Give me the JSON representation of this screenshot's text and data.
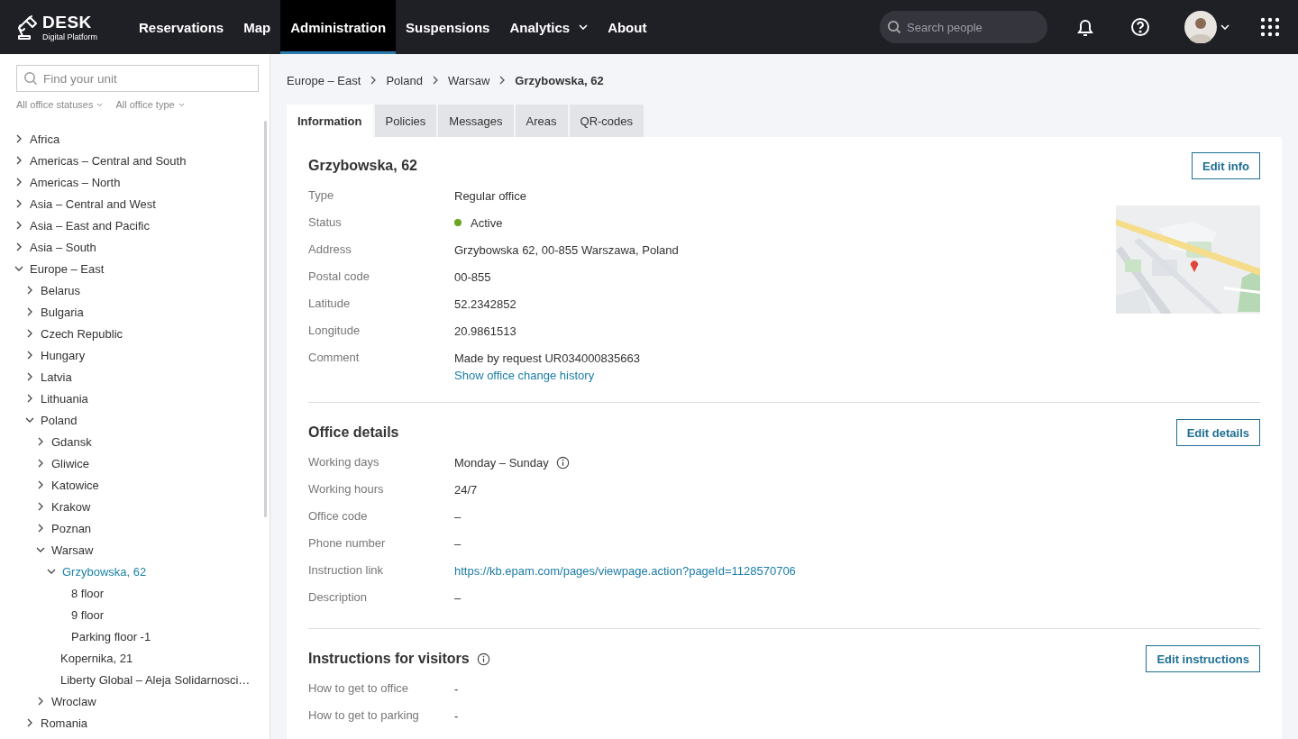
{
  "header": {
    "logo": {
      "title": "DESK",
      "subtitle": "Digital Platform"
    },
    "nav": [
      {
        "label": "Reservations",
        "selected": false,
        "dropdown": false
      },
      {
        "label": "Map",
        "selected": false,
        "dropdown": false
      },
      {
        "label": "Administration",
        "selected": true,
        "dropdown": false
      },
      {
        "label": "Suspensions",
        "selected": false,
        "dropdown": false
      },
      {
        "label": "Analytics",
        "selected": false,
        "dropdown": true
      },
      {
        "label": "About",
        "selected": false,
        "dropdown": false
      }
    ],
    "search": {
      "placeholder": "Search people"
    }
  },
  "sidebar": {
    "search": {
      "placeholder": "Find your unit"
    },
    "filters": [
      "All office statuses",
      "All office type"
    ],
    "tree": [
      {
        "label": "Africa",
        "kind": "group",
        "expanded": false,
        "selected": false
      },
      {
        "label": "Americas – Central and South",
        "kind": "group",
        "expanded": false,
        "selected": false
      },
      {
        "label": "Americas – North",
        "kind": "group",
        "expanded": false,
        "selected": false
      },
      {
        "label": "Asia – Central and West",
        "kind": "group",
        "expanded": false,
        "selected": false
      },
      {
        "label": "Asia – East and Pacific",
        "kind": "group",
        "expanded": false,
        "selected": false
      },
      {
        "label": "Asia – South",
        "kind": "group",
        "expanded": false,
        "selected": false
      },
      {
        "label": "Europe – East",
        "kind": "group",
        "expanded": true,
        "selected": false,
        "children": [
          {
            "label": "Belarus",
            "kind": "group",
            "expanded": false,
            "selected": false
          },
          {
            "label": "Bulgaria",
            "kind": "group",
            "expanded": false,
            "selected": false
          },
          {
            "label": "Czech Republic",
            "kind": "group",
            "expanded": false,
            "selected": false
          },
          {
            "label": "Hungary",
            "kind": "group",
            "expanded": false,
            "selected": false
          },
          {
            "label": "Latvia",
            "kind": "group",
            "expanded": false,
            "selected": false
          },
          {
            "label": "Lithuania",
            "kind": "group",
            "expanded": false,
            "selected": false
          },
          {
            "label": "Poland",
            "kind": "group",
            "expanded": true,
            "selected": false,
            "children": [
              {
                "label": "Gdansk",
                "kind": "group",
                "expanded": false,
                "selected": false
              },
              {
                "label": "Gliwice",
                "kind": "group",
                "expanded": false,
                "selected": false
              },
              {
                "label": "Katowice",
                "kind": "group",
                "expanded": false,
                "selected": false
              },
              {
                "label": "Krakow",
                "kind": "group",
                "expanded": false,
                "selected": false
              },
              {
                "label": "Poznan",
                "kind": "group",
                "expanded": false,
                "selected": false
              },
              {
                "label": "Warsaw",
                "kind": "group",
                "expanded": true,
                "selected": false,
                "children": [
                  {
                    "label": "Grzybowska, 62",
                    "kind": "group",
                    "expanded": true,
                    "selected": true,
                    "children": [
                      {
                        "label": "8 floor",
                        "kind": "leaf",
                        "selected": false
                      },
                      {
                        "label": "9 floor",
                        "kind": "leaf",
                        "selected": false
                      },
                      {
                        "label": "Parking floor -1",
                        "kind": "leaf",
                        "selected": false
                      }
                    ]
                  },
                  {
                    "label": "Kopernika, 21",
                    "kind": "leaf",
                    "selected": false
                  },
                  {
                    "label": "Liberty Global – Aleja Solidarnosci…",
                    "kind": "leaf",
                    "selected": false
                  }
                ]
              },
              {
                "label": "Wroclaw",
                "kind": "group",
                "expanded": false,
                "selected": false
              }
            ]
          },
          {
            "label": "Romania",
            "kind": "group",
            "expanded": false,
            "selected": false
          }
        ]
      }
    ]
  },
  "breadcrumb": [
    {
      "label": "Europe – East",
      "current": false
    },
    {
      "label": "Poland",
      "current": false
    },
    {
      "label": "Warsaw",
      "current": false
    },
    {
      "label": "Grzybowska, 62",
      "current": true
    }
  ],
  "tabs": [
    {
      "label": "Information",
      "selected": true
    },
    {
      "label": "Policies",
      "selected": false
    },
    {
      "label": "Messages",
      "selected": false
    },
    {
      "label": "Areas",
      "selected": false
    },
    {
      "label": "QR-codes",
      "selected": false
    }
  ],
  "sections": [
    {
      "title": "Grzybowska, 62",
      "kind": "summary",
      "edit_button": "Edit info",
      "fields": [
        {
          "label": "Type",
          "value": "Regular office",
          "kind": "text"
        },
        {
          "label": "Status",
          "value": "Active",
          "kind": "status",
          "color": "#6aa51f"
        },
        {
          "label": "Address",
          "value": "Grzybowska 62, 00-855 Warszawa, Poland",
          "kind": "text"
        },
        {
          "label": "Postal code",
          "value": "00-855",
          "kind": "text"
        },
        {
          "label": "Latitude",
          "value": "52.2342852",
          "kind": "text"
        },
        {
          "label": "Longitude",
          "value": "20.9861513",
          "kind": "text"
        },
        {
          "label": "Comment",
          "value": "Made by request UR034000835663",
          "kind": "text",
          "link": "Show office change history"
        }
      ]
    },
    {
      "title": "Office details",
      "kind": "details",
      "edit_button": "Edit details",
      "fields": [
        {
          "label": "Working days",
          "value": "Monday – Sunday",
          "kind": "info"
        },
        {
          "label": "Working hours",
          "value": "24/7",
          "kind": "text"
        },
        {
          "label": "Office code",
          "value": "–",
          "kind": "text"
        },
        {
          "label": "Phone number",
          "value": "–",
          "kind": "text"
        },
        {
          "label": "Instruction link",
          "value": "https://kb.epam.com/pages/viewpage.action?pageId=1128570706",
          "kind": "link"
        },
        {
          "label": "Description",
          "value": "–",
          "kind": "text"
        }
      ]
    },
    {
      "title": "Instructions for visitors",
      "kind": "instructions",
      "edit_button": "Edit instructions",
      "fields": [
        {
          "label": "How to get to office",
          "value": "-",
          "kind": "text"
        },
        {
          "label": "How to get to parking",
          "value": "-",
          "kind": "text"
        }
      ]
    }
  ]
}
